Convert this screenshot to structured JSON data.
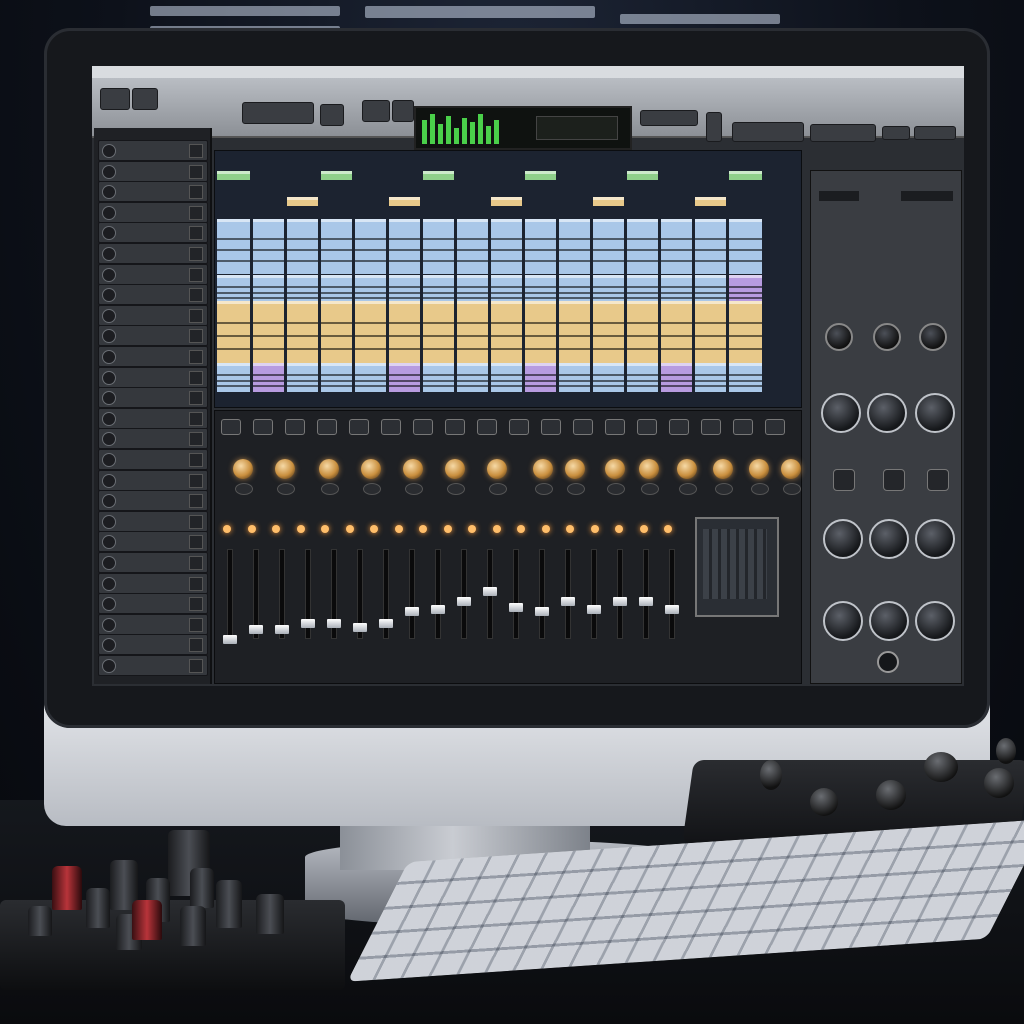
{
  "window": {
    "title": "",
    "menu_items": [
      "",
      "",
      "",
      "",
      "",
      ""
    ]
  },
  "toolbar": {
    "buttons": [
      "",
      "",
      "",
      "",
      "",
      "",
      "",
      "",
      ""
    ]
  },
  "tracklist": {
    "header": "",
    "tracks": [
      "",
      "",
      "",
      "",
      "",
      "",
      "",
      "",
      "",
      "",
      "",
      "",
      "",
      "",
      "",
      "",
      "",
      "",
      "",
      "",
      "",
      "",
      "",
      "",
      "",
      ""
    ]
  },
  "rack": {
    "title": ""
  },
  "mixer": {
    "section_label": ""
  },
  "colors": {
    "clip_blue": "#a9c7e8",
    "clip_gold": "#e8c98a",
    "clip_green": "#8fd08a",
    "clip_purple": "#b79be0",
    "knob_amber": "#e0a04a",
    "meter_green": "#4ad04a"
  },
  "icons": {
    "track_record": "record-dot-icon",
    "track_mute": "mute-icon",
    "transport": "play-icon"
  }
}
